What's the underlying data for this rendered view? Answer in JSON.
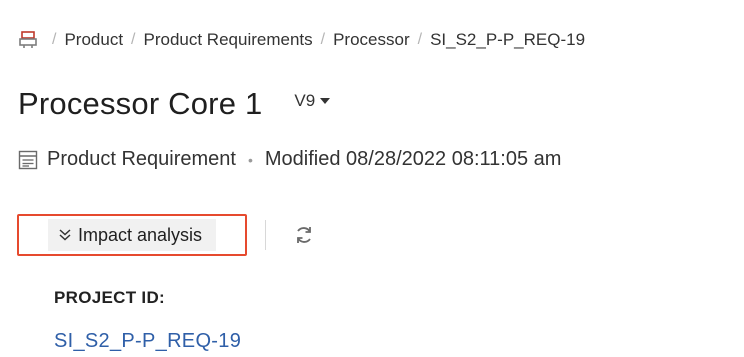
{
  "breadcrumb": {
    "home_icon": "home-icon",
    "items": [
      "Product",
      "Product Requirements",
      "Processor",
      "SI_S2_P-P_REQ-19"
    ],
    "separator": "/"
  },
  "header": {
    "title": "Processor Core 1",
    "version": "V9"
  },
  "meta": {
    "type_icon": "requirement-document-icon",
    "type": "Product Requirement",
    "separator": "•",
    "modified": "Modified 08/28/2022 08:11:05 am"
  },
  "actions": {
    "impact_analysis_label": "Impact analysis",
    "impact_icon": "double-chevron-down-icon",
    "refresh_icon": "refresh-icon",
    "highlight_color": "#e64a2e"
  },
  "fields": {
    "project_id_label": "PROJECT ID:",
    "project_id_value": "SI_S2_P-P_REQ-19"
  }
}
